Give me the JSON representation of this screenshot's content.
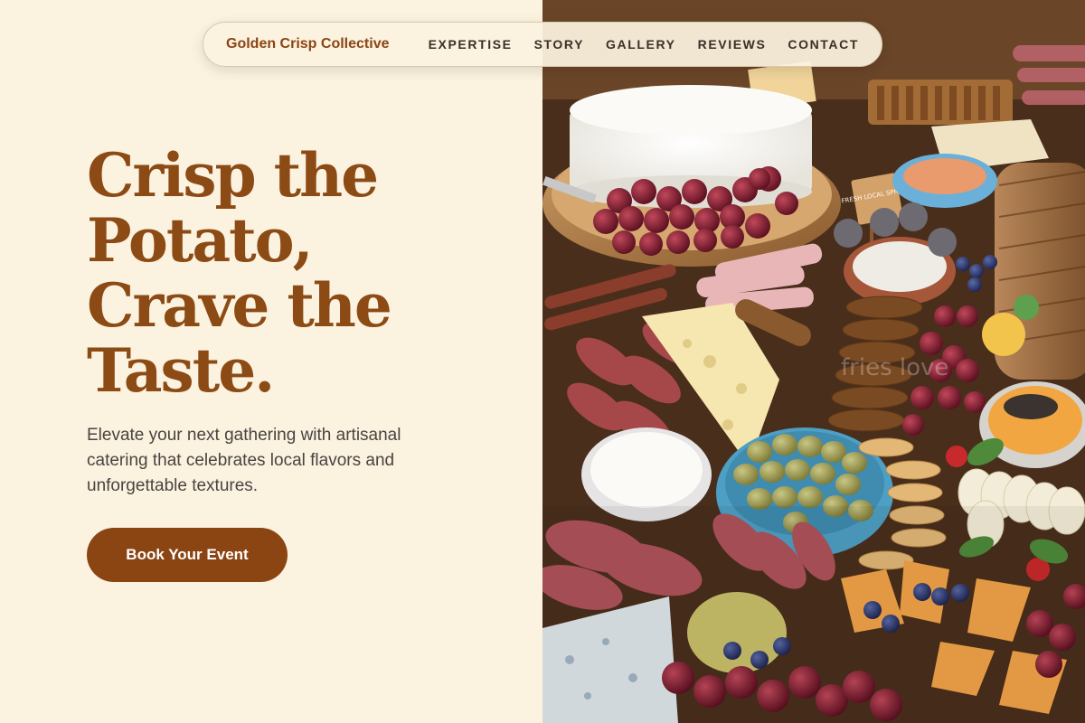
{
  "brand": {
    "name": "Golden Crisp Collective"
  },
  "nav": {
    "links": [
      {
        "label": "EXPERTISE"
      },
      {
        "label": "STORY"
      },
      {
        "label": "GALLERY"
      },
      {
        "label": "REVIEWS"
      },
      {
        "label": "CONTACT"
      }
    ]
  },
  "hero": {
    "headline_lines": [
      "Crisp the",
      "Potato,",
      "Crave the",
      "Taste."
    ],
    "tagline": "Elevate your next gathering with artisanal catering that celebrates local flavors and unforgettable textures.",
    "cta_label": "Book Your Event"
  },
  "photo": {
    "watermark": "fries love",
    "sign_text": "FRESH LOCAL SPREAD",
    "icon": "charcuterie-board-photo"
  },
  "colors": {
    "background": "#fbf2e0",
    "accent": "#8b4513",
    "headline": "#8c4a14",
    "body_text": "#4a4440"
  }
}
